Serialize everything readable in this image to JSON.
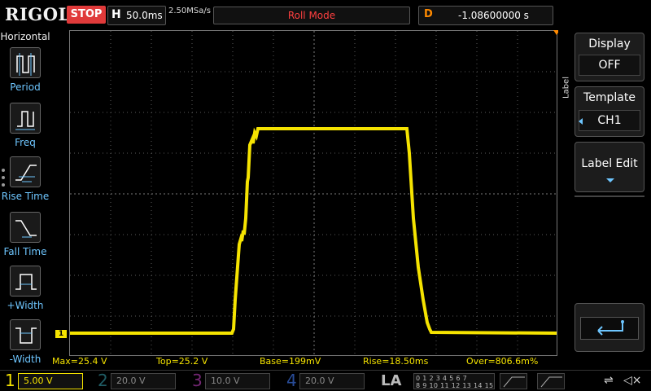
{
  "topbar": {
    "brand": "RIGOL",
    "run_state": "STOP",
    "timebase_label": "H",
    "timebase_value": "50.0ms",
    "sample_rate": "2.50MSa/s",
    "memory_depth": "",
    "acq_mode": "Roll Mode",
    "delay_label": "D",
    "delay_value": "-1.08600000 s"
  },
  "left_panel": {
    "title": "Horizontal",
    "items": [
      {
        "label": "Period",
        "icon": "period-icon"
      },
      {
        "label": "Freq",
        "icon": "frequency-icon"
      },
      {
        "label": "Rise Time",
        "icon": "rise-time-icon"
      },
      {
        "label": "Fall Time",
        "icon": "fall-time-icon"
      },
      {
        "label": "+Width",
        "icon": "positive-width-icon"
      },
      {
        "label": "-Width",
        "icon": "negative-width-icon"
      }
    ]
  },
  "right_panel": {
    "vertical_label": "Label",
    "display_title": "Display",
    "display_value": "OFF",
    "template_title": "Template",
    "template_value": "CH1",
    "label_edit": "Label Edit"
  },
  "channel_marker": "1",
  "measurements": [
    {
      "label": "Max=25.4 V"
    },
    {
      "label": "Top=25.2 V"
    },
    {
      "label": "Base=199mV"
    },
    {
      "label": "Rise=18.50ms"
    },
    {
      "label": "Over=806.6m%"
    }
  ],
  "channels": [
    {
      "num": "1",
      "scale": "5.00 V",
      "color": "#f5e300",
      "active": true
    },
    {
      "num": "2",
      "scale": "20.0 V",
      "color": "#3fb8c8",
      "active": false
    },
    {
      "num": "3",
      "scale": "10.0 V",
      "color": "#c040c0",
      "active": false
    },
    {
      "num": "4",
      "scale": "20.0 V",
      "color": "#3a6cd8",
      "active": false
    }
  ],
  "la_label": "LA",
  "la_rows": [
    "0 1 2 3  4 5 6 7",
    "8 9 10 11 12 13 14 15"
  ],
  "colors": {
    "trace": "#f5e300",
    "stop": "#e03a3a",
    "accent": "#6ec6ff",
    "delay": "#ff8a00"
  }
}
